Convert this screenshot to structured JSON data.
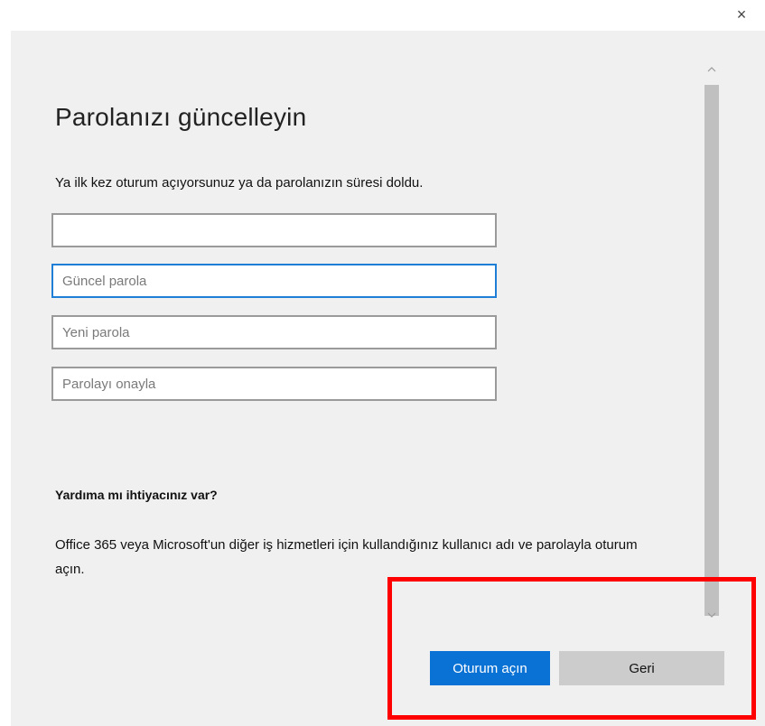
{
  "window": {
    "close_glyph": "×"
  },
  "dialog": {
    "title": "Parolanızı güncelleyin",
    "subtitle": "Ya ilk kez oturum açıyorsunuz ya da parolanızın süresi doldu.",
    "fields": {
      "username": {
        "value": "",
        "placeholder": ""
      },
      "current_password": {
        "value": "",
        "placeholder": "Güncel parola"
      },
      "new_password": {
        "value": "",
        "placeholder": "Yeni parola"
      },
      "confirm_password": {
        "value": "",
        "placeholder": "Parolayı onayla"
      }
    },
    "help": {
      "title": "Yardıma mı ihtiyacınız var?",
      "text": "Office 365 veya Microsoft'un diğer iş hizmetleri için kullandığınız kullanıcı adı ve parolayla oturum açın."
    },
    "buttons": {
      "sign_in": "Oturum açın",
      "back": "Geri"
    }
  },
  "colors": {
    "accent": "#0b72d5",
    "focus_border": "#1f7fd6",
    "highlight": "#ff0000",
    "dialog_bg": "#f0f0f0"
  },
  "icons": {
    "close": "close-icon",
    "scroll_up": "chevron-up-icon",
    "scroll_down": "chevron-down-icon"
  }
}
